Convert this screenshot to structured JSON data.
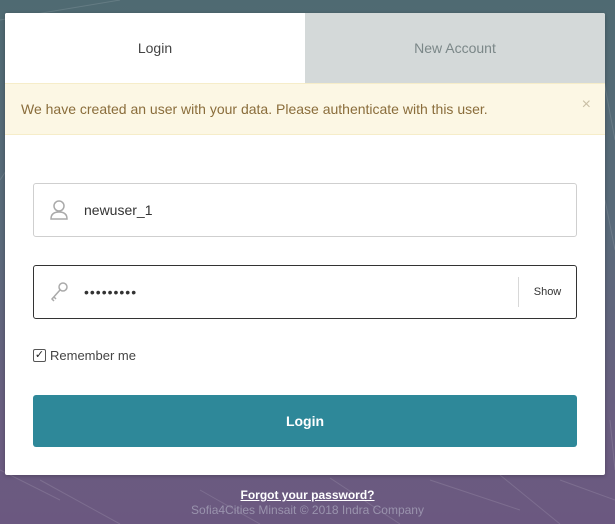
{
  "tabs": {
    "login": "Login",
    "new_account": "New Account"
  },
  "alert": {
    "message": "We have created an user with your data. Please authenticate with this user.",
    "close_symbol": "×"
  },
  "form": {
    "username_value": "newuser_1",
    "password_masked": "•••••••••",
    "show_label": "Show",
    "remember_label": "Remember me",
    "remember_checked": true,
    "check_symbol": "✓",
    "submit_label": "Login"
  },
  "footer": {
    "forgot_password": "Forgot your password?",
    "copyright": "Sofia4Cities Minsait © 2018 Indra Company"
  },
  "icons": {
    "username": "user-icon",
    "password": "key-icon",
    "close": "close-icon"
  },
  "colors": {
    "primary_button": "#2e8899",
    "alert_background": "#fcf7e4",
    "alert_text": "#8a6d3b",
    "inactive_tab": "#d4d9d9"
  }
}
